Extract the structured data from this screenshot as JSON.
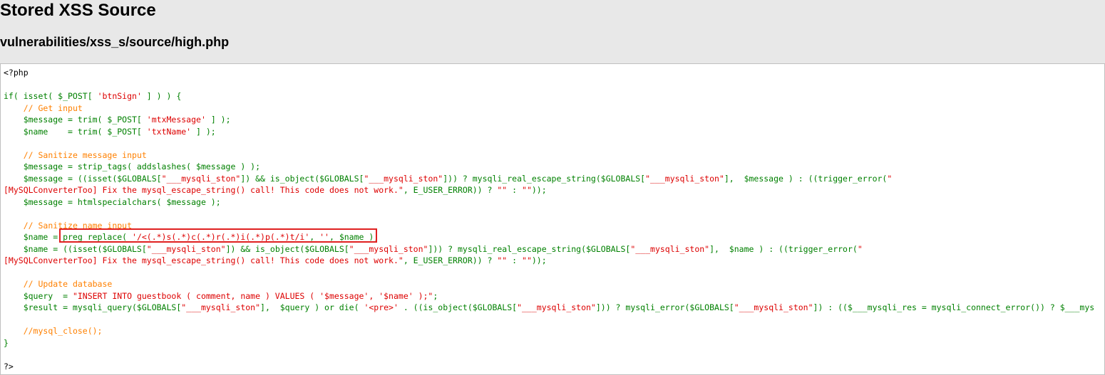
{
  "page": {
    "title": "Stored XSS Source",
    "file_path": "vulnerabilities/xss_s/source/high.php"
  },
  "colors": {
    "default": "#000000",
    "keyword": "#008000",
    "comment": "#ff8000",
    "string": "#dd0000",
    "highlight_border": "#e02020"
  },
  "code_lines": [
    [
      {
        "t": "<?php",
        "c": "def"
      }
    ],
    [],
    [
      {
        "t": "if( isset( $_POST[ ",
        "c": "kw"
      },
      {
        "t": "'btnSign'",
        "c": "str"
      },
      {
        "t": " ] ) ) {",
        "c": "kw"
      }
    ],
    [
      {
        "t": "    ",
        "c": "kw"
      },
      {
        "t": "// Get input",
        "c": "com"
      }
    ],
    [
      {
        "t": "    $message = trim( $_POST[ ",
        "c": "kw"
      },
      {
        "t": "'mtxMessage'",
        "c": "str"
      },
      {
        "t": " ] );",
        "c": "kw"
      }
    ],
    [
      {
        "t": "    $name    = trim( $_POST[ ",
        "c": "kw"
      },
      {
        "t": "'txtName'",
        "c": "str"
      },
      {
        "t": " ] );",
        "c": "kw"
      }
    ],
    [],
    [
      {
        "t": "    ",
        "c": "kw"
      },
      {
        "t": "// Sanitize message input",
        "c": "com"
      }
    ],
    [
      {
        "t": "    $message = strip_tags( addslashes( $message ) );",
        "c": "kw"
      }
    ],
    [
      {
        "t": "    $message = ((isset($GLOBALS[",
        "c": "kw"
      },
      {
        "t": "\"___mysqli_ston\"",
        "c": "str"
      },
      {
        "t": "]) && is_object($GLOBALS[",
        "c": "kw"
      },
      {
        "t": "\"___mysqli_ston\"",
        "c": "str"
      },
      {
        "t": "])) ? mysqli_real_escape_string($GLOBALS[",
        "c": "kw"
      },
      {
        "t": "\"___mysqli_ston\"",
        "c": "str"
      },
      {
        "t": "],  $message ) : ((trigger_error(",
        "c": "kw"
      },
      {
        "t": "\"",
        "c": "str"
      }
    ],
    [
      {
        "t": "[MySQLConverterToo] Fix the mysql_escape_string() call! This code does not work.\"",
        "c": "str"
      },
      {
        "t": ", E_USER_ERROR)) ? ",
        "c": "kw"
      },
      {
        "t": "\"\"",
        "c": "str"
      },
      {
        "t": " : ",
        "c": "kw"
      },
      {
        "t": "\"\"",
        "c": "str"
      },
      {
        "t": "));",
        "c": "kw"
      }
    ],
    [
      {
        "t": "    $message = htmlspecialchars( $message );",
        "c": "kw"
      }
    ],
    [],
    [
      {
        "t": "    ",
        "c": "kw"
      },
      {
        "t": "// Sanitize name input",
        "c": "com"
      }
    ],
    [
      {
        "t": "    $name = preg_replace( ",
        "c": "kw"
      },
      {
        "t": "'/<(.*)s(.*)c(.*)r(.*)i(.*)p(.*)t/i'",
        "c": "str"
      },
      {
        "t": ", ",
        "c": "kw"
      },
      {
        "t": "''",
        "c": "str"
      },
      {
        "t": ", $name );",
        "c": "kw"
      }
    ],
    [
      {
        "t": "    $name = ((isset($GLOBALS[",
        "c": "kw"
      },
      {
        "t": "\"___mysqli_ston\"",
        "c": "str"
      },
      {
        "t": "]) && is_object($GLOBALS[",
        "c": "kw"
      },
      {
        "t": "\"___mysqli_ston\"",
        "c": "str"
      },
      {
        "t": "])) ? mysqli_real_escape_string($GLOBALS[",
        "c": "kw"
      },
      {
        "t": "\"___mysqli_ston\"",
        "c": "str"
      },
      {
        "t": "],  $name ) : ((trigger_error(",
        "c": "kw"
      },
      {
        "t": "\"",
        "c": "str"
      }
    ],
    [
      {
        "t": "[MySQLConverterToo] Fix the mysql_escape_string() call! This code does not work.\"",
        "c": "str"
      },
      {
        "t": ", E_USER_ERROR)) ? ",
        "c": "kw"
      },
      {
        "t": "\"\"",
        "c": "str"
      },
      {
        "t": " : ",
        "c": "kw"
      },
      {
        "t": "\"\"",
        "c": "str"
      },
      {
        "t": "));",
        "c": "kw"
      }
    ],
    [],
    [
      {
        "t": "    ",
        "c": "kw"
      },
      {
        "t": "// Update database",
        "c": "com"
      }
    ],
    [
      {
        "t": "    $query  = ",
        "c": "kw"
      },
      {
        "t": "\"INSERT INTO guestbook ( comment, name ) VALUES ( '$message', '$name' );\"",
        "c": "str"
      },
      {
        "t": ";",
        "c": "kw"
      }
    ],
    [
      {
        "t": "    $result = mysqli_query($GLOBALS[",
        "c": "kw"
      },
      {
        "t": "\"___mysqli_ston\"",
        "c": "str"
      },
      {
        "t": "],  $query ) or die( ",
        "c": "kw"
      },
      {
        "t": "'<pre>'",
        "c": "str"
      },
      {
        "t": " . ((is_object($GLOBALS[",
        "c": "kw"
      },
      {
        "t": "\"___mysqli_ston\"",
        "c": "str"
      },
      {
        "t": "])) ? mysqli_error($GLOBALS[",
        "c": "kw"
      },
      {
        "t": "\"___mysqli_ston\"",
        "c": "str"
      },
      {
        "t": "]) : (($___mysqli_res = mysqli_connect_error()) ? $___mys",
        "c": "kw"
      }
    ],
    [],
    [
      {
        "t": "    ",
        "c": "kw"
      },
      {
        "t": "//mysql_close();",
        "c": "com"
      }
    ],
    [
      {
        "t": "}",
        "c": "kw"
      }
    ],
    [],
    [
      {
        "t": "?>",
        "c": "def"
      }
    ]
  ]
}
